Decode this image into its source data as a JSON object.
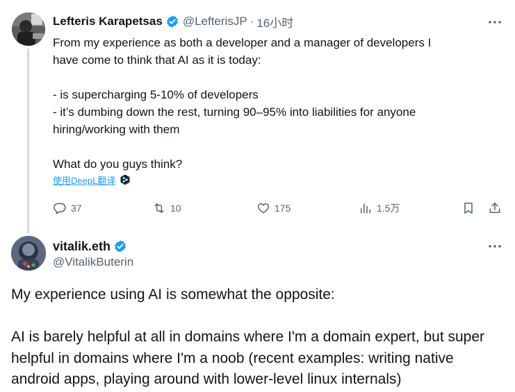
{
  "colors": {
    "text": "#0f1419",
    "secondary": "#536471",
    "accent": "#1d9bf0",
    "thread_line": "#cfd9de"
  },
  "tweet1": {
    "author_name": "Lefteris Karapetsas",
    "handle": "@LefterisJP",
    "separator": "·",
    "time": "16小时",
    "verified_icon": "verified-badge-icon",
    "more_icon": "more-icon",
    "body_lines": [
      "From my experience as both a developer and a manager of developers I",
      "have come to think that AI as it is today:",
      "",
      "- is supercharging 5-10% of developers",
      "- it’s dumbing down the rest, turning 90–95% into liabilities for anyone",
      "hiring/working with them",
      "",
      "What do you guys think?"
    ],
    "translate_label": "使用DeepL翻译",
    "translate_icon": "deepl-icon",
    "actions": {
      "reply_count": "37",
      "retweet_count": "10",
      "like_count": "175",
      "views_count": "1.5万",
      "reply_icon": "reply-icon",
      "retweet_icon": "retweet-icon",
      "like_icon": "heart-icon",
      "views_icon": "views-icon",
      "bookmark_icon": "bookmark-icon",
      "share_icon": "share-icon"
    }
  },
  "tweet2": {
    "author_name": "vitalik.eth",
    "handle": "@VitalikButerin",
    "verified_icon": "verified-badge-icon",
    "more_icon": "more-icon",
    "body_lines": [
      "My experience using AI is somewhat the opposite:",
      "",
      "AI is barely helpful at all in domains where I'm a domain expert, but super",
      "helpful in domains where I'm a noob (recent examples: writing native",
      "android apps, playing around with lower-level linux internals)"
    ]
  }
}
